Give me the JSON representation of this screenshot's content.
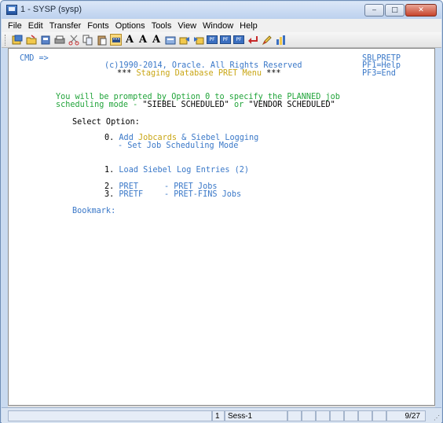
{
  "window": {
    "title": "1 - SYSP (sysp)",
    "buttons": {
      "minimize": "‒",
      "maximize": "□",
      "close": "✕"
    }
  },
  "menu": {
    "items": [
      {
        "label": "File"
      },
      {
        "label": "Edit"
      },
      {
        "label": "Transfer"
      },
      {
        "label": "Fonts"
      },
      {
        "label": "Options"
      },
      {
        "label": "Tools"
      },
      {
        "label": "View"
      },
      {
        "label": "Window"
      },
      {
        "label": "Help"
      }
    ]
  },
  "toolbar": {
    "icons": [
      "new-session-icon",
      "open-icon",
      "print-icon",
      "print-screen-icon",
      "cut-icon",
      "copy-icon",
      "paste-icon",
      "keyboard-map-icon",
      "font-a-icon",
      "font-a-smaller-icon",
      "font-a-larger-icon",
      "macro-icon",
      "send-icon",
      "receive-icon",
      "pf-icon",
      "pf2-icon",
      "pf3-icon",
      "enter-icon",
      "edit-icon",
      "chart-icon"
    ],
    "font_glyphs": [
      "A",
      "A",
      "A"
    ],
    "pf_labels": [
      "PF",
      "PF",
      "PF"
    ]
  },
  "screen": {
    "cmd_label": "CMD =>",
    "panel_id": "SBLPRETP",
    "copyright": "(c)1990-2014, Oracle. All Rights Reserved",
    "pf1": "PF1=Help",
    "menu_title_stars_left": "***",
    "menu_title": "Staging Database PRET Menu",
    "menu_title_stars_right": "***",
    "prompt_line1": "You will be prompted by Option 0 to specify the PLANNED job",
    "pf3": "PF3=End",
    "prompt_line2_a": "scheduling mode - ",
    "prompt_line2_b": "\"SIEBEL SCHEDULED\"",
    "prompt_line2_c": " or ",
    "prompt_line2_d": "\"VENDOR SCHEDULED\"",
    "select_option": "Select Option:",
    "opt0_num": "0.",
    "opt0_add": "Add ",
    "opt0_jobcards": "Jobcards",
    "opt0_rest": " & Siebel Logging",
    "opt0_sub": "- Set Job Scheduling Mode",
    "opt1_num": "1.",
    "opt1_text": "Load Siebel Log Entries (2)",
    "opt2_num": "2.",
    "opt2_code": "PRET",
    "opt2_desc": "- PRET Jobs",
    "opt3_num": "3.",
    "opt3_code": "PRETF",
    "opt3_desc": "- PRET-FINS Jobs",
    "bookmark": "Bookmark:"
  },
  "status": {
    "session_num": "1",
    "session_name": "Sess-1",
    "page": "9/27"
  }
}
